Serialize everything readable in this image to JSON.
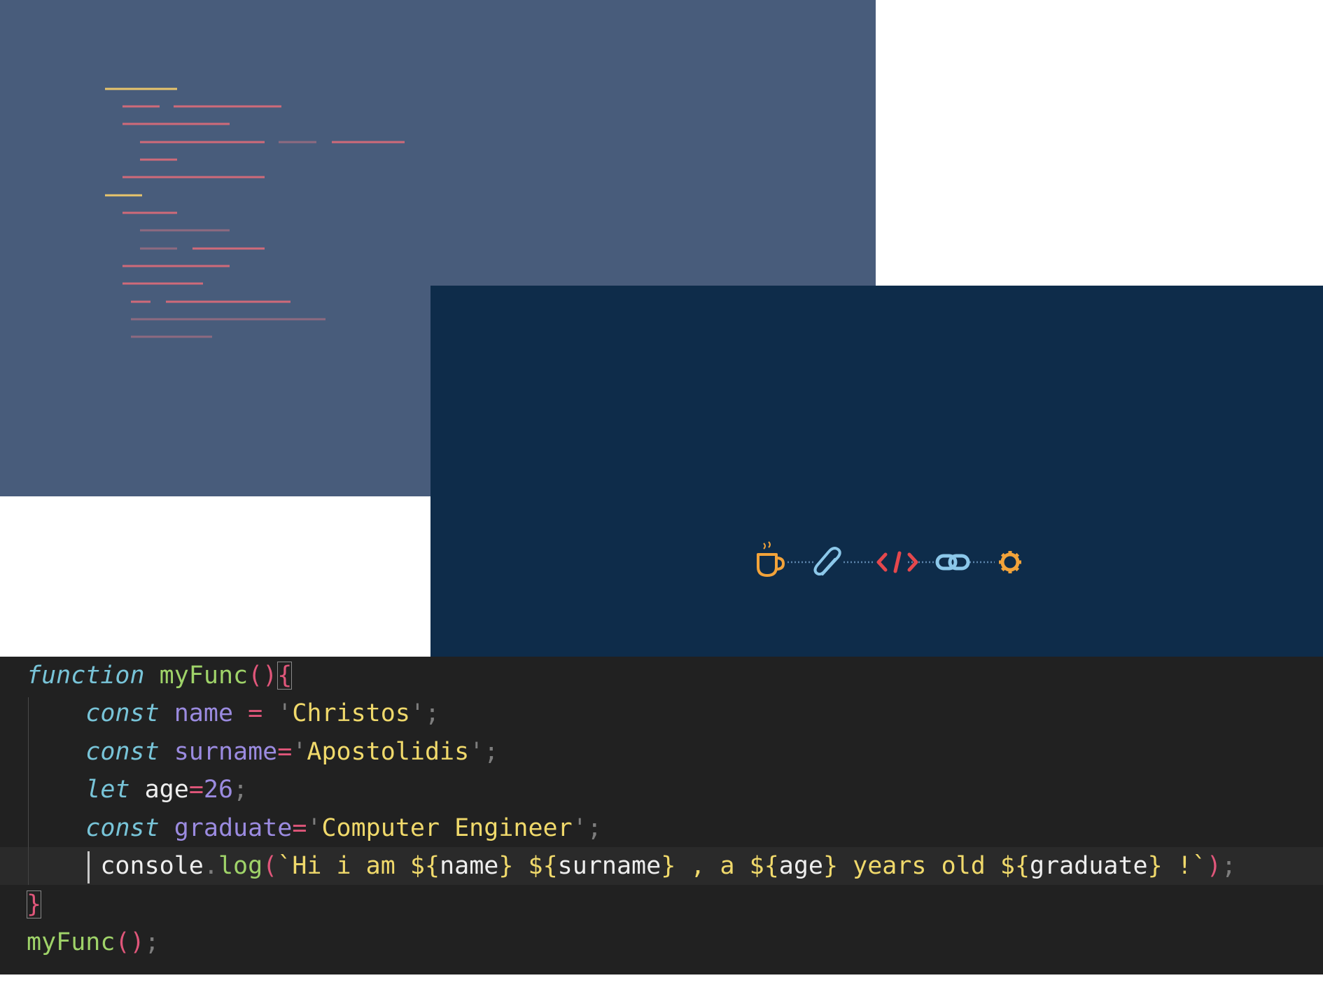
{
  "colors": {
    "slate": "#485c7b",
    "navy": "#0e2c4a",
    "editor_bg": "#212121",
    "code_yellow": "#e8c56b",
    "code_pink": "#cf6a79",
    "code_pink_dim": "#8e6a80",
    "keyword": "#78c4d8",
    "function": "#9fd369",
    "variable": "#9b8be0",
    "operator": "#e0567a",
    "string": "#f0d96b",
    "number": "#9b8be0",
    "punct": "#7d7d7d",
    "bracket": "#e0567a",
    "text": "#eeeeee",
    "icon_orange": "#f2a33a",
    "icon_light_blue": "#8cc8ea",
    "icon_red": "#e5484d",
    "chain_dots": "#5d86ad"
  },
  "icons": [
    "coffee-cup-icon",
    "paperclip-icon",
    "code-brackets-icon",
    "chain-link-icon",
    "gear-icon"
  ],
  "editor": {
    "lines": [
      [
        {
          "t": "function",
          "c": "kw"
        },
        {
          "t": " ",
          "c": "tx"
        },
        {
          "t": "myFunc",
          "c": "fn"
        },
        {
          "t": "()",
          "c": "br"
        },
        {
          "t": "{",
          "c": "br",
          "box": true
        }
      ],
      [
        {
          "t": "    ",
          "c": "tx"
        },
        {
          "t": "const",
          "c": "kw"
        },
        {
          "t": " ",
          "c": "tx"
        },
        {
          "t": "name",
          "c": "vr"
        },
        {
          "t": " = ",
          "c": "op"
        },
        {
          "t": "'",
          "c": "pn"
        },
        {
          "t": "Christos",
          "c": "st"
        },
        {
          "t": "'",
          "c": "pn"
        },
        {
          "t": ";",
          "c": "pn"
        }
      ],
      [
        {
          "t": "    ",
          "c": "tx"
        },
        {
          "t": "const",
          "c": "kw"
        },
        {
          "t": " ",
          "c": "tx"
        },
        {
          "t": "surname",
          "c": "vr"
        },
        {
          "t": "=",
          "c": "op"
        },
        {
          "t": "'",
          "c": "pn"
        },
        {
          "t": "Apostolidis",
          "c": "st"
        },
        {
          "t": "'",
          "c": "pn"
        },
        {
          "t": ";",
          "c": "pn"
        }
      ],
      [
        {
          "t": "    ",
          "c": "tx"
        },
        {
          "t": "let",
          "c": "kw"
        },
        {
          "t": " ",
          "c": "tx"
        },
        {
          "t": "age",
          "c": "tx"
        },
        {
          "t": "=",
          "c": "op"
        },
        {
          "t": "26",
          "c": "nm"
        },
        {
          "t": ";",
          "c": "pn"
        }
      ],
      [
        {
          "t": "    ",
          "c": "tx"
        },
        {
          "t": "const",
          "c": "kw"
        },
        {
          "t": " ",
          "c": "tx"
        },
        {
          "t": "graduate",
          "c": "vr"
        },
        {
          "t": "=",
          "c": "op"
        },
        {
          "t": "'",
          "c": "pn"
        },
        {
          "t": "Computer Engineer",
          "c": "st"
        },
        {
          "t": "'",
          "c": "pn"
        },
        {
          "t": ";",
          "c": "pn"
        }
      ],
      [
        {
          "t": "     ",
          "c": "tx"
        },
        {
          "t": "console",
          "c": "tx"
        },
        {
          "t": ".",
          "c": "pn"
        },
        {
          "t": "log",
          "c": "fn"
        },
        {
          "t": "(",
          "c": "br"
        },
        {
          "t": "`",
          "c": "st"
        },
        {
          "t": "Hi i am ",
          "c": "st"
        },
        {
          "t": "${",
          "c": "st"
        },
        {
          "t": "name",
          "c": "tx"
        },
        {
          "t": "}",
          "c": "st"
        },
        {
          "t": " ",
          "c": "st"
        },
        {
          "t": "${",
          "c": "st"
        },
        {
          "t": "surname",
          "c": "tx"
        },
        {
          "t": "}",
          "c": "st"
        },
        {
          "t": " , a ",
          "c": "st"
        },
        {
          "t": "${",
          "c": "st"
        },
        {
          "t": "age",
          "c": "tx"
        },
        {
          "t": "}",
          "c": "st"
        },
        {
          "t": " years old ",
          "c": "st"
        },
        {
          "t": "${",
          "c": "st"
        },
        {
          "t": "graduate",
          "c": "tx"
        },
        {
          "t": "}",
          "c": "st"
        },
        {
          "t": " !",
          "c": "st"
        },
        {
          "t": "`",
          "c": "st"
        },
        {
          "t": ")",
          "c": "br"
        },
        {
          "t": ";",
          "c": "pn"
        }
      ],
      [
        {
          "t": "}",
          "c": "br",
          "box": true
        }
      ],
      [
        {
          "t": "myFunc",
          "c": "fn"
        },
        {
          "t": "()",
          "c": "br"
        },
        {
          "t": ";",
          "c": "pn"
        }
      ]
    ]
  }
}
